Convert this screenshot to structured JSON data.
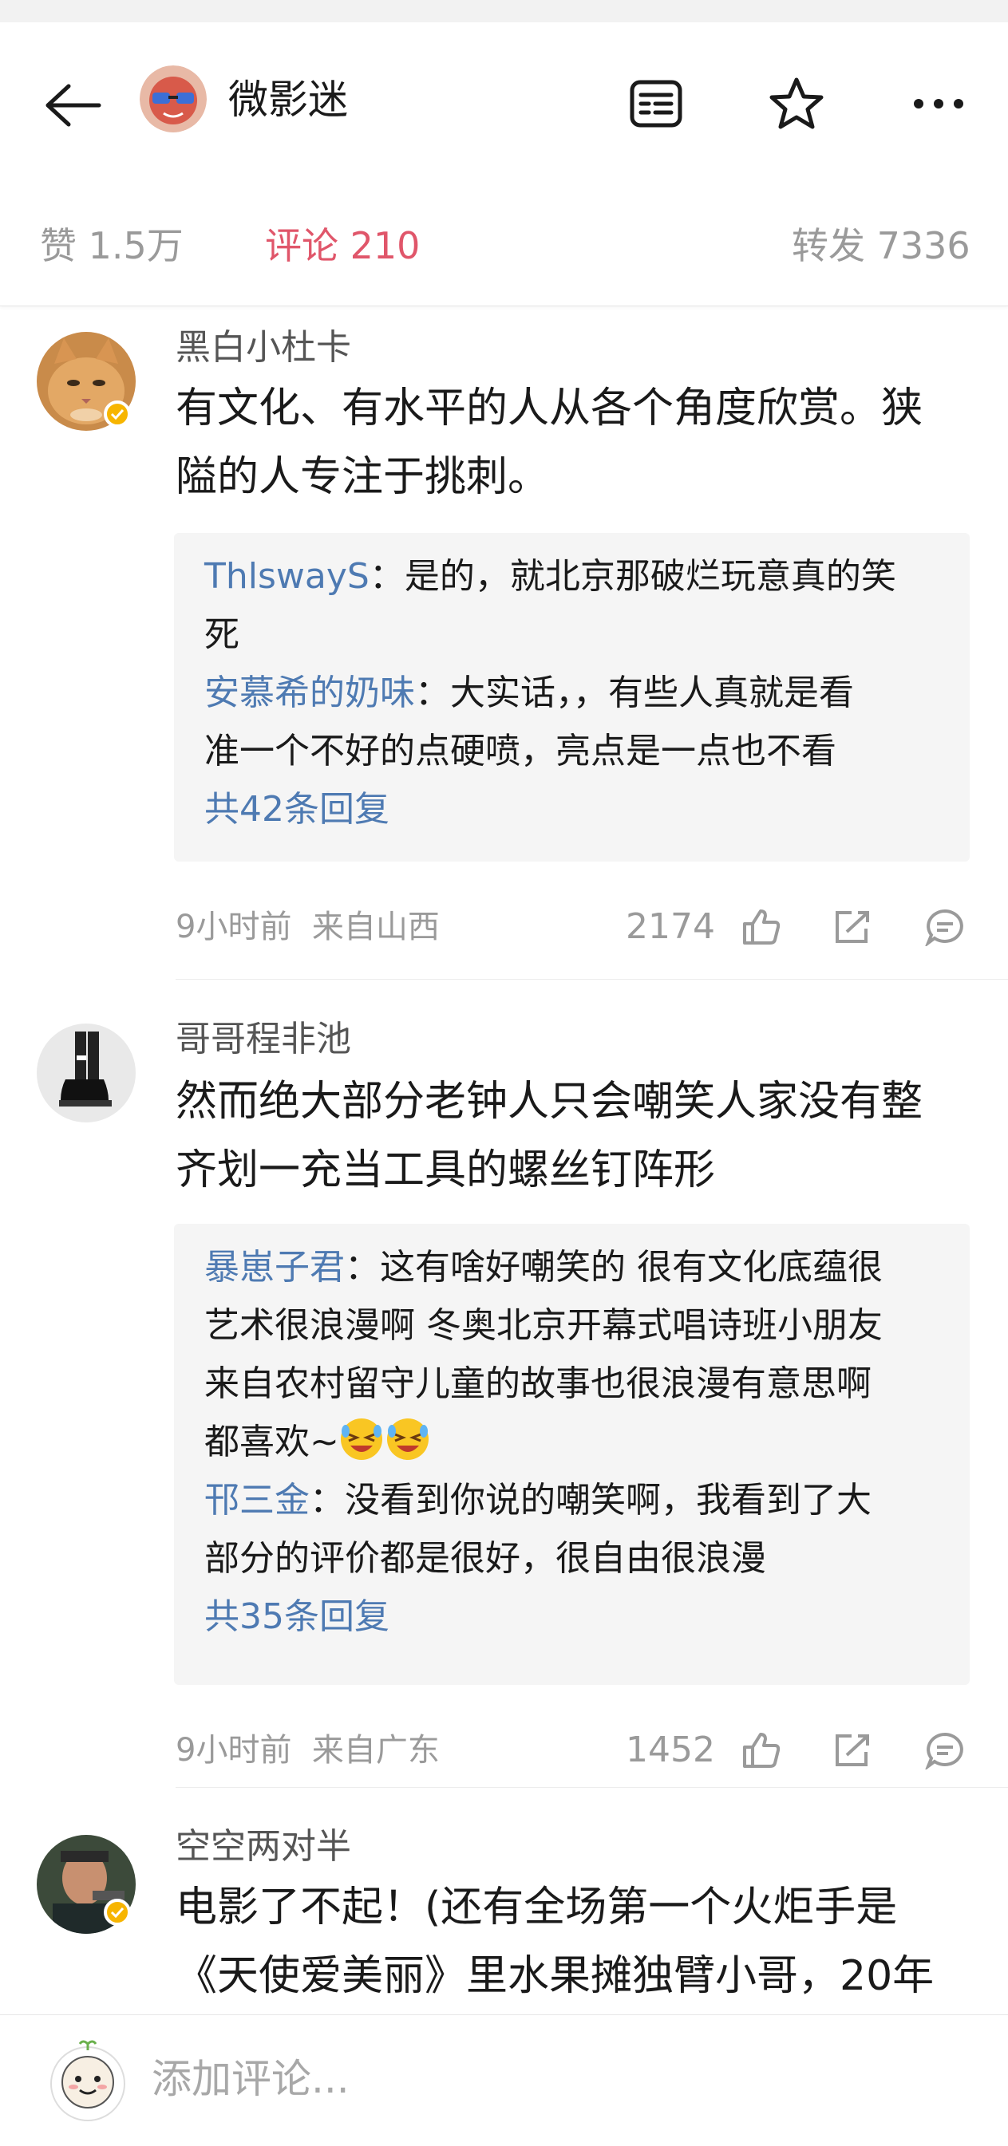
{
  "header": {
    "title": "微影迷",
    "tabs": [
      {
        "label": "赞 1.5万"
      },
      {
        "label": "评论 210"
      },
      {
        "label": "转发 7336"
      }
    ],
    "active_color": "#e0566a",
    "icons": [
      "back-arrow-icon",
      "news-icon",
      "star-icon",
      "more-icon"
    ]
  },
  "comments": [
    {
      "user": "黑白小杜卡",
      "text_lines": [
        "有文化、有水平的人从各个角度欣赏。狭",
        "隘的人专注于挑刺。"
      ],
      "verified": true,
      "replies": [
        {
          "user": "ThlswayS",
          "text_lines": [
            "：是的，就北京那破烂玩意真的笑",
            "死"
          ]
        },
        {
          "user": "安慕希的奶味",
          "text_lines": [
            "：大实话，，有些人真就是看",
            "准一个不好的点硬喷，亮点是一点也不看"
          ]
        }
      ],
      "more_replies": "共42条回复",
      "time": "9小时前",
      "location": "来自山西",
      "likes": "2174"
    },
    {
      "user": "哥哥程非池",
      "text_lines": [
        "然而绝大部分老钟人只会嘲笑人家没有整",
        "齐划一充当工具的螺丝钉阵形"
      ],
      "verified": false,
      "replies": [
        {
          "user": "暴崽子君",
          "text_lines": [
            "：这有啥好嘲笑的 很有文化底蕴很",
            "艺术很浪漫啊 冬奥北京开幕式唱诗班小朋友",
            "来自农村留守儿童的故事也很浪漫有意思啊",
            "都喜欢~"
          ]
        },
        {
          "user": "邗三金",
          "text_lines": [
            "：没看到你说的嘲笑啊，我看到了大",
            "部分的评价都是很好，很自由很浪漫"
          ]
        }
      ],
      "more_replies": "共35条回复",
      "time": "9小时前",
      "location": "来自广东",
      "likes": "1452"
    },
    {
      "user": "空空两对半",
      "text_lines": [
        "电影了不起！(还有全场第一个火炬手是",
        "《天使爱美丽》里水果摊独臂小哥，20年"
      ],
      "verified": true
    }
  ],
  "footer": {
    "placeholder": "添加评论..."
  }
}
